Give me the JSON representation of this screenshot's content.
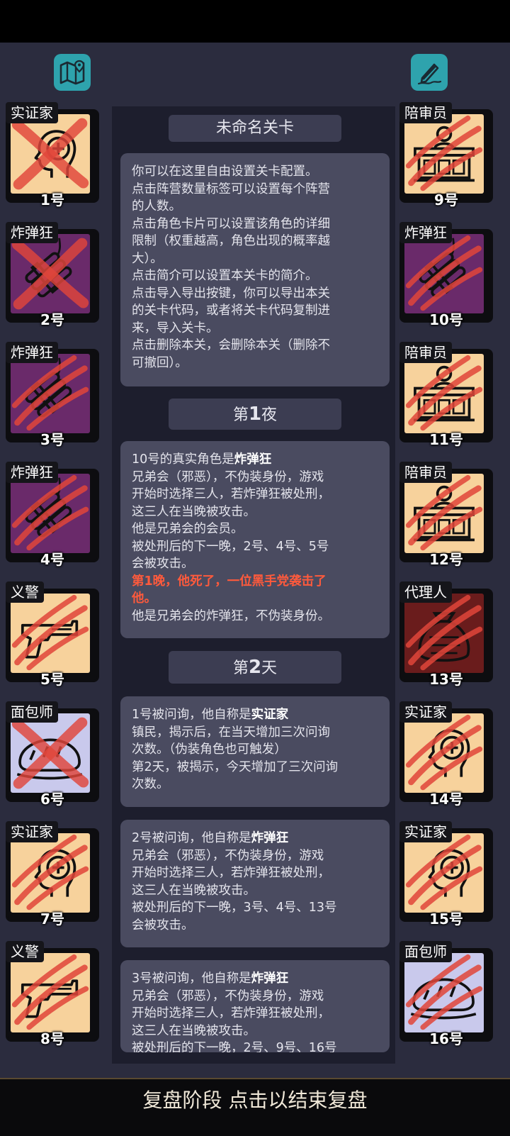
{
  "top_icons": {
    "left": "map-icon",
    "right": "edit-icon"
  },
  "level_title": "未命名关卡",
  "intro_lines": [
    "你可以在这里自由设置关卡配置。",
    "点击阵营数量标签可以设置每个阵营",
    "的人数。",
    "点击角色卡片可以设置该角色的详细",
    "限制（权重越高，角色出现的概率越",
    "大）。",
    "点击简介可以设置本关卡的简介。",
    "点击导入导出按键，你可以导出本关",
    "的关卡代码，或者将关卡代码复制进",
    "来，导入关卡。",
    "点击删除本关，会删除本关（删除不",
    "可撤回）。"
  ],
  "night1": {
    "pre": "第",
    "num": "1",
    "post": "夜"
  },
  "day2": {
    "pre": "第",
    "num": "2",
    "post": "天"
  },
  "msg1": {
    "head_pre": "10号的真实角色是",
    "head_role": "炸弹狂",
    "lines": [
      "兄弟会（邪恶），不伪装身份，游戏",
      "开始时选择三人，若炸弹狂被处刑，",
      "这三人在当晚被攻击。",
      "他是兄弟会的会员。",
      "被处刑后的下一晚，2号、4号、5号",
      "会被攻击。"
    ],
    "red_lines": [
      "第1晚，他死了，一位黑手党袭击了",
      "他。"
    ],
    "tail": "他是兄弟会的炸弹狂，不伪装身份。"
  },
  "msg2": {
    "head_pre": "1号被问询，他自称是",
    "head_role": "实证家",
    "lines": [
      "镇民，揭示后，在当天增加三次问询",
      "次数。（伪装角色也可触发）",
      "第2天，被揭示，今天增加了三次问询",
      "次数。"
    ]
  },
  "msg3": {
    "head_pre": "2号被问询，他自称是",
    "head_role": "炸弹狂",
    "lines": [
      "兄弟会（邪恶），不伪装身份，游戏",
      "开始时选择三人，若炸弹狂被处刑，",
      "这三人在当晚被攻击。",
      "被处刑后的下一晚，3号、4号、13号",
      "会被攻击。"
    ]
  },
  "msg4": {
    "head_pre": "3号被问询，他自称是",
    "head_role": "炸弹狂",
    "lines": [
      "兄弟会（邪恶），不伪装身份，游戏",
      "开始时选择三人，若炸弹狂被处刑，",
      "这三人在当晚被攻击。",
      "被处刑后的下一晚，2号、9号、16号"
    ]
  },
  "left_cards": [
    {
      "role": "实证家",
      "num": "1号",
      "icon": "head-plus-icon",
      "bg": "#f7d29c",
      "mark": "x"
    },
    {
      "role": "炸弹狂",
      "num": "2号",
      "icon": "bomb-icon",
      "bg": "#6a2a6a",
      "mark": "x"
    },
    {
      "role": "炸弹狂",
      "num": "3号",
      "icon": "bomb-icon",
      "bg": "#6a2a6a",
      "mark": "claw"
    },
    {
      "role": "炸弹狂",
      "num": "4号",
      "icon": "bomb-icon",
      "bg": "#6a2a6a",
      "mark": "claw"
    },
    {
      "role": "义警",
      "num": "5号",
      "icon": "gun-icon",
      "bg": "#f7d29c",
      "mark": "claw"
    },
    {
      "role": "面包师",
      "num": "6号",
      "icon": "bread-icon",
      "bg": "#c9c9ec",
      "mark": "x"
    },
    {
      "role": "实证家",
      "num": "7号",
      "icon": "head-plus-icon",
      "bg": "#f7d29c",
      "mark": "claw"
    },
    {
      "role": "义警",
      "num": "8号",
      "icon": "gun-icon",
      "bg": "#f7d29c",
      "mark": "claw"
    }
  ],
  "right_cards": [
    {
      "role": "陪审员",
      "num": "9号",
      "icon": "jury-icon",
      "bg": "#f7d29c",
      "mark": "claw"
    },
    {
      "role": "炸弹狂",
      "num": "10号",
      "icon": "bomb-icon",
      "bg": "#6a2a6a",
      "mark": "claw"
    },
    {
      "role": "陪审员",
      "num": "11号",
      "icon": "jury-icon",
      "bg": "#f7d29c",
      "mark": "claw"
    },
    {
      "role": "陪审员",
      "num": "12号",
      "icon": "jury-icon",
      "bg": "#f7d29c",
      "mark": "claw"
    },
    {
      "role": "代理人",
      "num": "13号",
      "icon": "moneybag-icon",
      "bg": "#6a1c1c",
      "mark": "claw"
    },
    {
      "role": "实证家",
      "num": "14号",
      "icon": "head-plus-icon",
      "bg": "#f7d29c",
      "mark": "claw"
    },
    {
      "role": "实证家",
      "num": "15号",
      "icon": "head-plus-icon",
      "bg": "#f7d29c",
      "mark": "claw"
    },
    {
      "role": "面包师",
      "num": "16号",
      "icon": "bread-icon",
      "bg": "#c9c9ec",
      "mark": "claw"
    }
  ],
  "bottom_text": "复盘阶段 点击以结束复盘"
}
